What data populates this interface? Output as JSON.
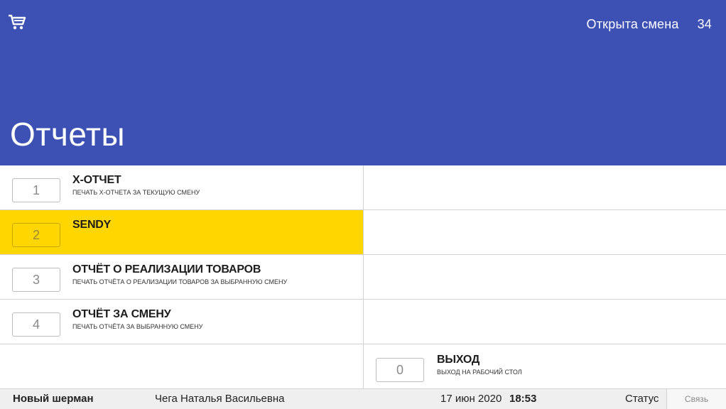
{
  "header": {
    "title": "Отчеты",
    "shift_status": "Открыта смена",
    "shift_number": "34",
    "cart_icon": "cart-icon",
    "bg_color": "#3d51b5"
  },
  "menu": [
    {
      "key": "1",
      "title": "X-ОТЧЕТ",
      "subtitle": "ПЕЧАТЬ Х-ОТЧЕТА ЗА ТЕКУЩУЮ СМЕНУ"
    },
    {
      "key": "2",
      "title": "SENDY",
      "subtitle": ""
    },
    {
      "key": "3",
      "title": "ОТЧЁТ О РЕАЛИЗАЦИИ ТОВАРОВ",
      "subtitle": "ПЕЧАТЬ ОТЧЁТА О РЕАЛИЗАЦИИ ТОВАРОВ ЗА ВЫБРАННУЮ СМЕНУ"
    },
    {
      "key": "4",
      "title": "ОТЧЁТ ЗА СМЕНУ",
      "subtitle": "ПЕЧАТЬ ОТЧЁТА ЗА ВЫБРАННУЮ СМЕНУ"
    }
  ],
  "exit": {
    "key": "0",
    "title": "ВЫХОД",
    "subtitle": "ВЫХОД НА РАБОЧИЙ СТОЛ"
  },
  "selected_color": "#ffd600",
  "footer": {
    "company": "Новый шерман",
    "user": "Чега Наталья Васильевна",
    "date": "17 июн 2020",
    "time": "18:53",
    "status": "Статус",
    "link": "Связь"
  }
}
